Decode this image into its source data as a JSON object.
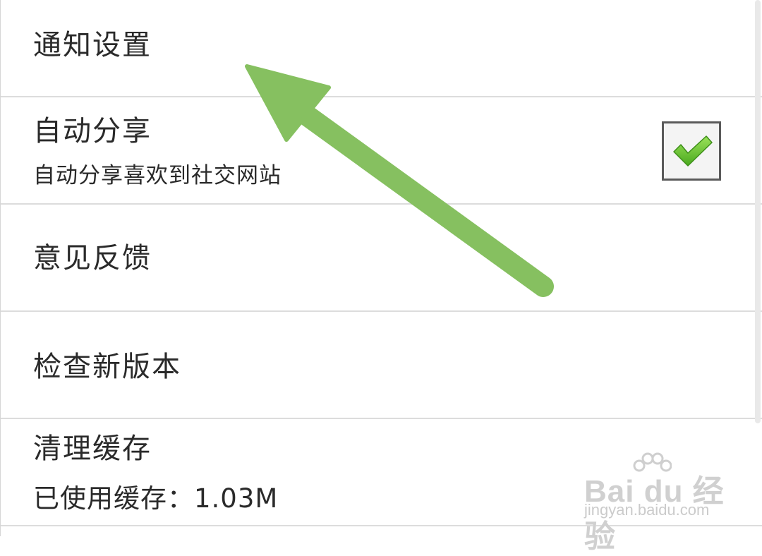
{
  "settings": {
    "notification_settings": "通知设置",
    "auto_share": {
      "title": "自动分享",
      "subtitle": "自动分享喜欢到社交网站",
      "checked": true
    },
    "feedback": "意见反馈",
    "check_update": "检查新版本",
    "clear_cache": {
      "title": "清理缓存",
      "subtitle": "已使用缓存：1.03M"
    }
  },
  "annotation": {
    "arrow_color": "#86c060",
    "points_to": "通知设置"
  },
  "watermark": {
    "logo": "Bai du 经验",
    "url": "jingyan.baidu.com"
  },
  "colors": {
    "check": "#6fc23a",
    "divider": "#dcdcdc",
    "text": "#2a2a2a"
  }
}
